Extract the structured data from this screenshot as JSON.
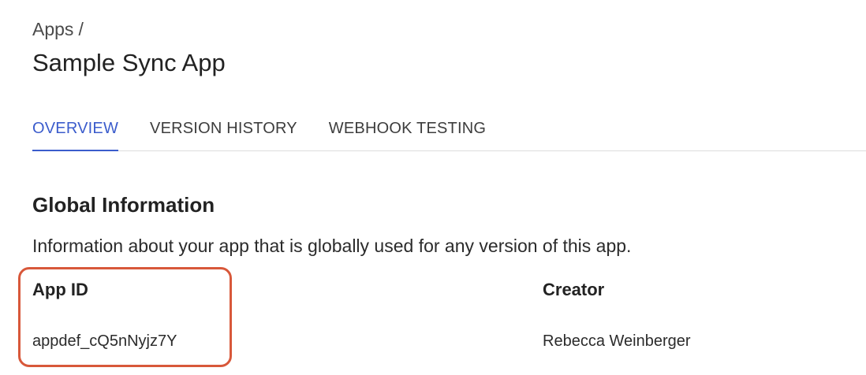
{
  "breadcrumb": {
    "parent": "Apps",
    "separator": "/"
  },
  "page": {
    "title": "Sample Sync App"
  },
  "tabs": [
    {
      "label": "OVERVIEW",
      "active": true
    },
    {
      "label": "VERSION HISTORY",
      "active": false
    },
    {
      "label": "WEBHOOK TESTING",
      "active": false
    }
  ],
  "global_info": {
    "title": "Global Information",
    "description": "Information about your app that is globally used for any version of this app.",
    "app_id_label": "App ID",
    "app_id_value": "appdef_cQ5nNyjz7Y",
    "creator_label": "Creator",
    "creator_value": "Rebecca Weinberger"
  },
  "colors": {
    "accent": "#3b5ccc",
    "highlight": "#d8583a"
  }
}
